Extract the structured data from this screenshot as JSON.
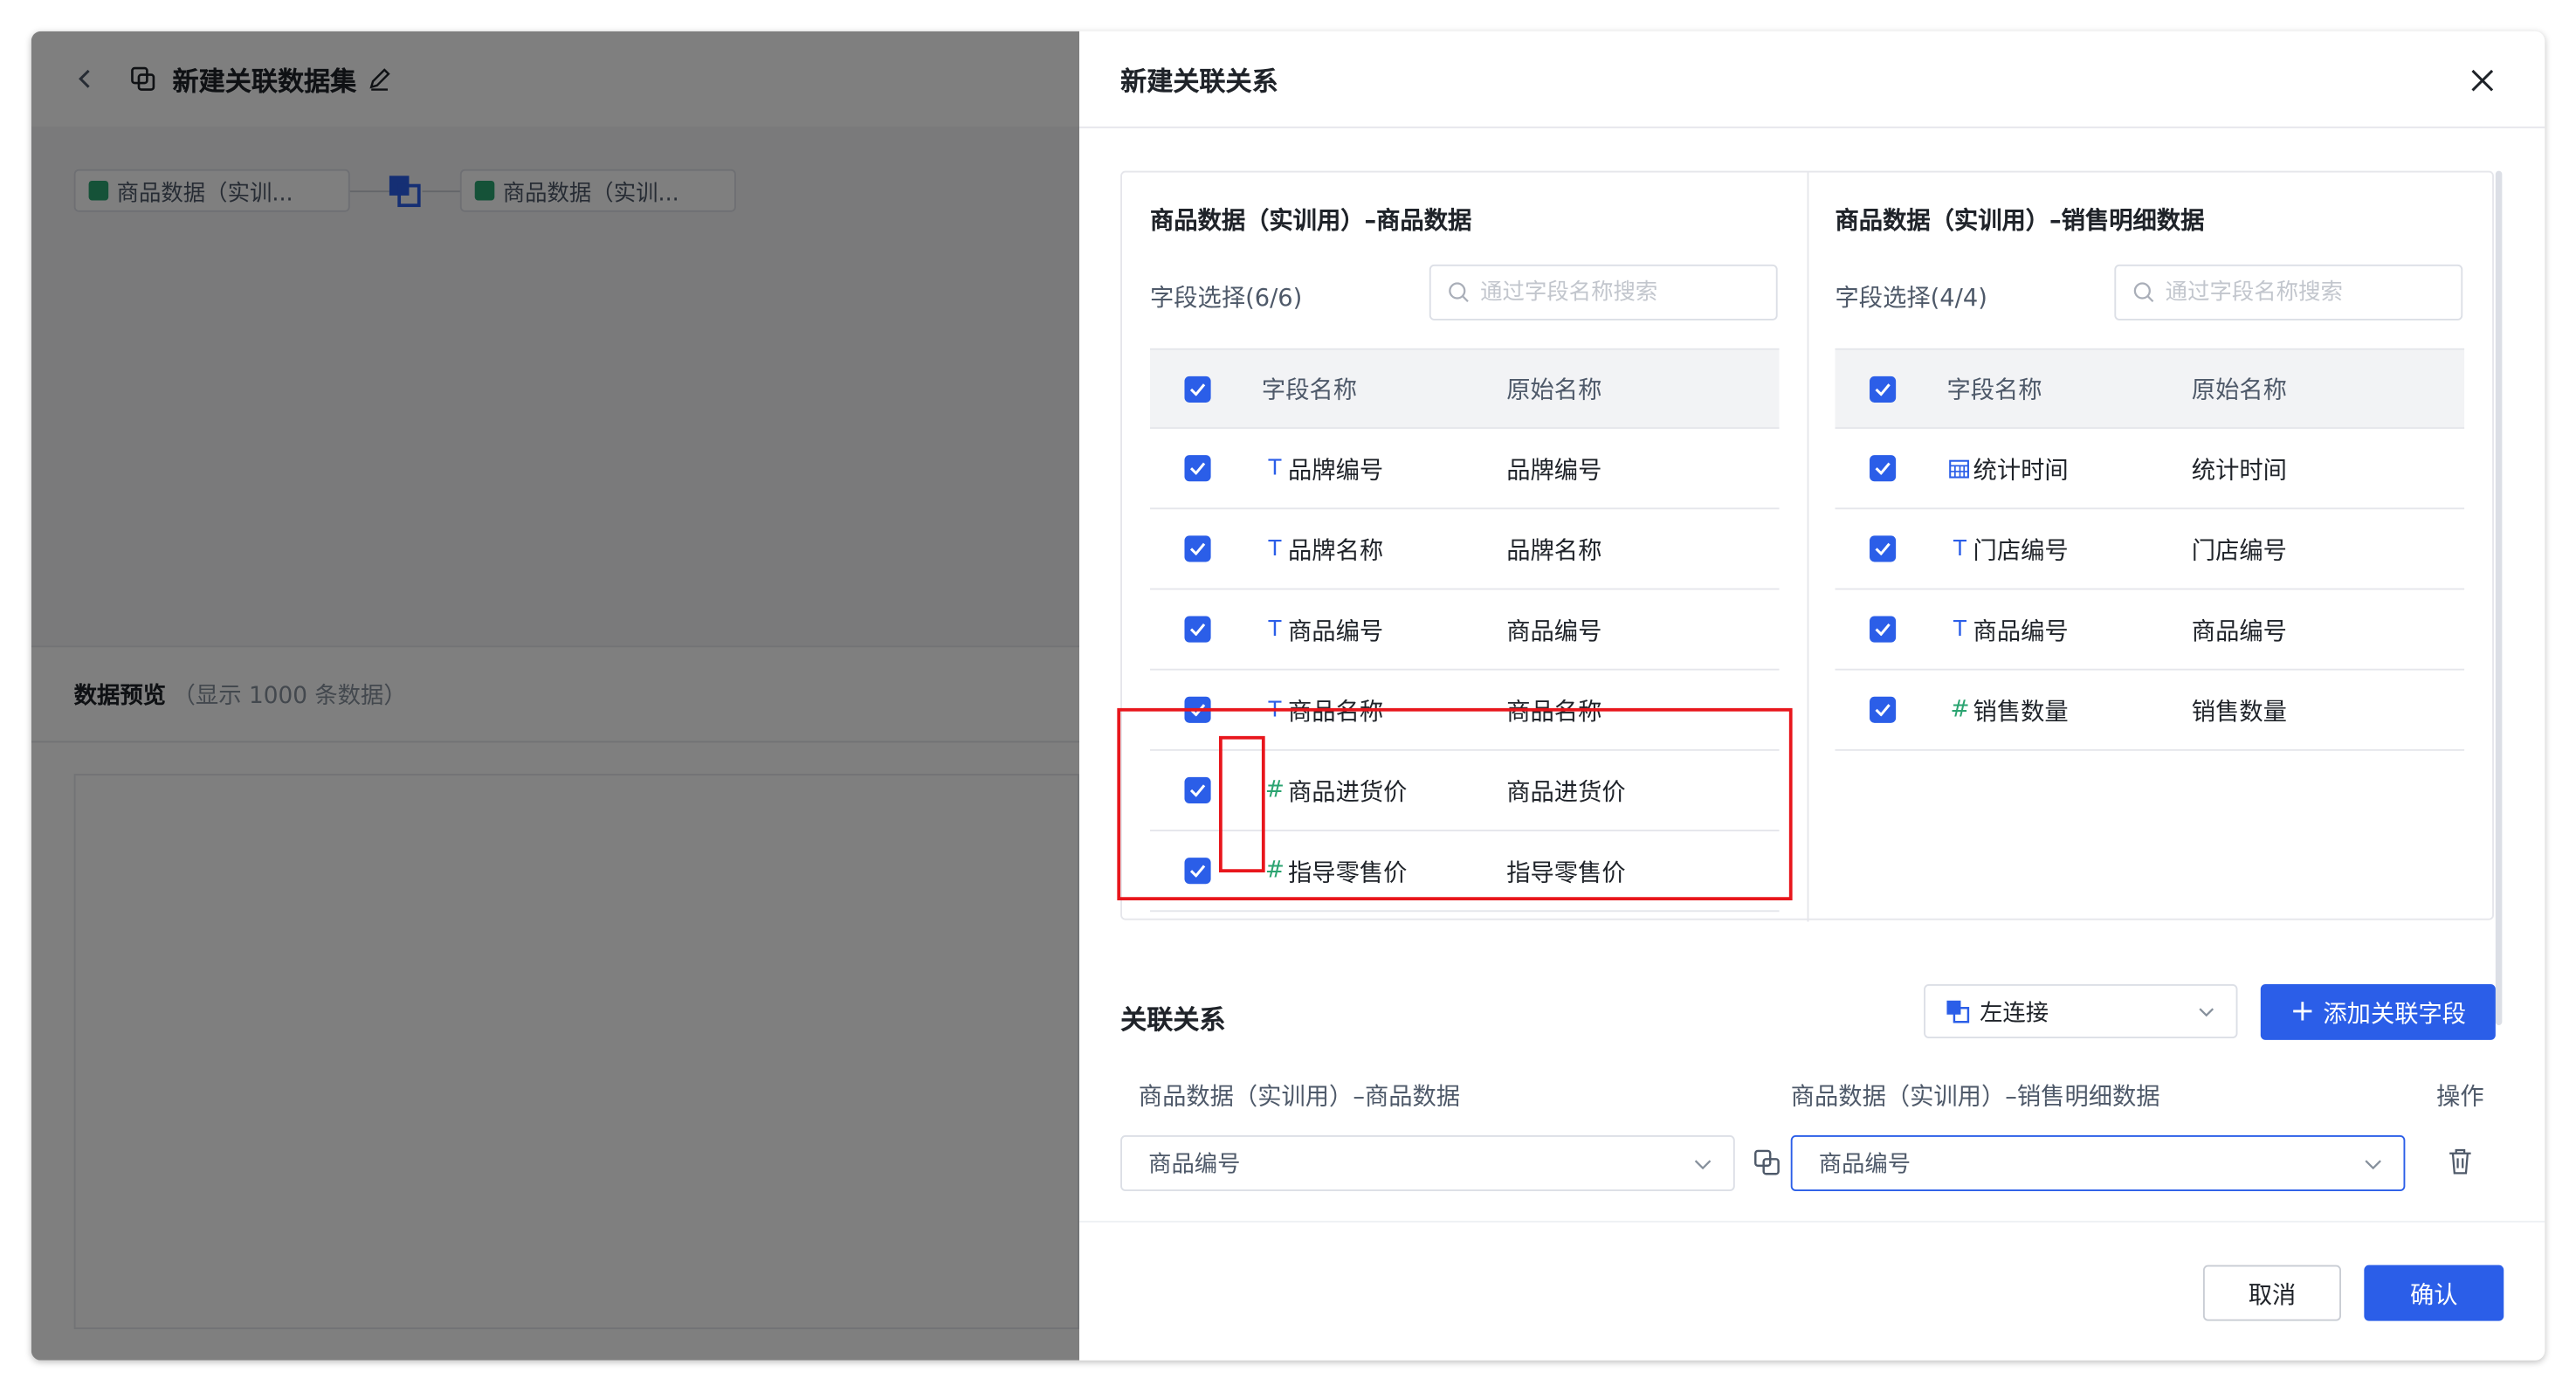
{
  "background": {
    "title": "新建关联数据集",
    "node_left": "商品数据（实训...",
    "node_right": "商品数据（实训...",
    "preview_title": "数据预览",
    "preview_sub": "（显示 1000 条数据）"
  },
  "drawer": {
    "title": "新建关联关系",
    "left_table": {
      "title": "商品数据（实训用）–商品数据",
      "field_count": "字段选择(6/6)",
      "search_placeholder": "通过字段名称搜索",
      "headers": {
        "name": "字段名称",
        "original": "原始名称"
      },
      "rows": [
        {
          "type": "T",
          "name": "品牌编号",
          "original": "品牌编号"
        },
        {
          "type": "T",
          "name": "品牌名称",
          "original": "品牌名称"
        },
        {
          "type": "T",
          "name": "商品编号",
          "original": "商品编号"
        },
        {
          "type": "T",
          "name": "商品名称",
          "original": "商品名称"
        },
        {
          "type": "#",
          "name": "商品进货价",
          "original": "商品进货价"
        },
        {
          "type": "#",
          "name": "指导零售价",
          "original": "指导零售价"
        }
      ]
    },
    "right_table": {
      "title": "商品数据（实训用）–销售明细数据",
      "field_count": "字段选择(4/4)",
      "search_placeholder": "通过字段名称搜索",
      "headers": {
        "name": "字段名称",
        "original": "原始名称"
      },
      "rows": [
        {
          "type": "date",
          "name": "统计时间",
          "original": "统计时间"
        },
        {
          "type": "T",
          "name": "门店编号",
          "original": "门店编号"
        },
        {
          "type": "T",
          "name": "商品编号",
          "original": "商品编号"
        },
        {
          "type": "#",
          "name": "销售数量",
          "original": "销售数量"
        }
      ]
    },
    "relation": {
      "title": "关联关系",
      "join_type": "左连接",
      "add_button": "添加关联字段",
      "left_header": "商品数据（实训用）–商品数据",
      "right_header": "商品数据（实训用）–销售明细数据",
      "op_header": "操作",
      "left_field": "商品编号",
      "right_field": "商品编号"
    },
    "cancel_label": "取消",
    "confirm_label": "确认"
  },
  "colors": {
    "primary": "#2b5ee8",
    "number_type": "#2ba471",
    "annotation": "#e8161c"
  }
}
